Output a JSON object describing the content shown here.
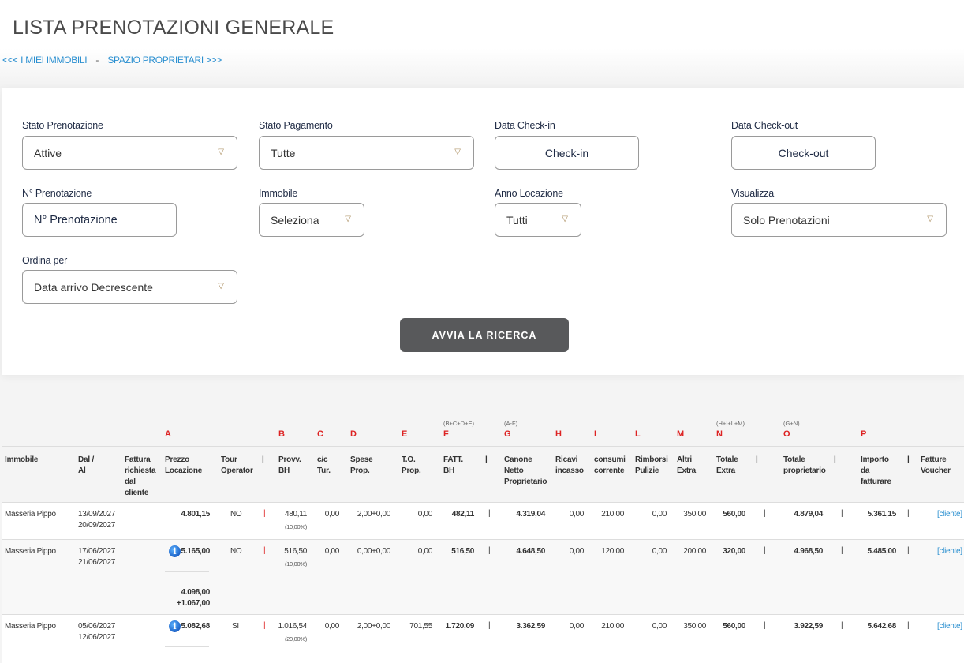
{
  "page": {
    "title": "LISTA PRENOTAZIONI GENERALE",
    "nav": {
      "back_link": "<<< I MIEI IMMOBILI",
      "separator": "-",
      "forward_link": "SPAZIO PROPRIETARI >>>"
    }
  },
  "filters": {
    "stato_prenotazione": {
      "label": "Stato Prenotazione",
      "value": "Attive"
    },
    "stato_pagamento": {
      "label": "Stato Pagamento",
      "value": "Tutte"
    },
    "data_checkin": {
      "label": "Data Check-in",
      "placeholder": "Check-in"
    },
    "data_checkout": {
      "label": "Data Check-out",
      "placeholder": "Check-out"
    },
    "numero_prenotazione": {
      "label": "N° Prenotazione",
      "placeholder": "N° Prenotazione"
    },
    "immobile": {
      "label": "Immobile",
      "value": "Seleziona"
    },
    "anno_locazione": {
      "label": "Anno Locazione",
      "value": "Tutti"
    },
    "visualizza": {
      "label": "Visualizza",
      "value": "Solo Prenotazioni"
    },
    "ordina_per": {
      "label": "Ordina per",
      "value": "Data arrivo Decrescente"
    },
    "caret_icon": "triangle-down-icon",
    "search_button": "AVVIA LA RICERCA"
  },
  "table": {
    "formulas": {
      "F": "(B+C+D+E)",
      "G": "(A-F)",
      "N": "(H+I+L+M)",
      "O": "(G+N)"
    },
    "letters": {
      "A": "A",
      "B": "B",
      "C": "C",
      "D": "D",
      "E": "E",
      "F": "F",
      "G": "G",
      "H": "H",
      "I": "I",
      "L": "L",
      "M": "M",
      "N": "N",
      "O": "O",
      "P": "P"
    },
    "headers": {
      "immobile": "Immobile",
      "dal_al": [
        "Dal /",
        "Al"
      ],
      "fattura": [
        "Fattura",
        "richiesta",
        "dal",
        "cliente"
      ],
      "prezzo": [
        "Prezzo",
        "Locazione"
      ],
      "tour": [
        "Tour",
        "Operator"
      ],
      "provv": [
        "Provv.",
        "BH"
      ],
      "cc": [
        "c/c",
        "Tur."
      ],
      "spese": [
        "Spese",
        "Prop."
      ],
      "to": [
        "T.O.",
        "Prop."
      ],
      "fatt": [
        "FATT.",
        "BH"
      ],
      "canone": [
        "Canone",
        "Netto",
        "Proprietario"
      ],
      "ricavi": [
        "Ricavi",
        "incasso"
      ],
      "consumi": [
        "consumi",
        "corrente"
      ],
      "rimborsi": [
        "Rimborsi",
        "Pulizie"
      ],
      "altri": [
        "Altri",
        "Extra"
      ],
      "totale_extra": [
        "Totale",
        "Extra"
      ],
      "totale_prop": [
        "Totale",
        "proprietario"
      ],
      "importo": [
        "Importo",
        "da",
        "fatturare"
      ],
      "fatture": [
        "Fatture",
        "Voucher"
      ],
      "pipe": "|"
    },
    "rows": [
      {
        "immobile": "Masseria Pippo",
        "dal": "13/09/2027",
        "al": "20/09/2027",
        "prezzo": "4.801,15",
        "tour": "NO",
        "provv": "480,11",
        "provv_pct": "(10,00%)",
        "cc": "0,00",
        "spese": "2,00+0,00",
        "to": "0,00",
        "fatt": "482,11",
        "canone": "4.319,04",
        "ricavi": "0,00",
        "consumi": "210,00",
        "rimborsi": "0,00",
        "altri": "350,00",
        "totale_extra": "560,00",
        "totale_prop": "4.879,04",
        "importo": "5.361,15",
        "voucher": "[cliente]"
      },
      {
        "immobile": "Masseria Pippo",
        "dal": "17/06/2027",
        "al": "21/06/2027",
        "prezzo": "5.165,00",
        "prezzo_detail": [
          "4.098,00",
          "+1.067,00"
        ],
        "info_icon": "info-icon",
        "tour": "NO",
        "provv": "516,50",
        "provv_pct": "(10,00%)",
        "cc": "0,00",
        "spese": "0,00+0,00",
        "to": "0,00",
        "fatt": "516,50",
        "canone": "4.648,50",
        "ricavi": "0,00",
        "consumi": "120,00",
        "rimborsi": "0,00",
        "altri": "200,00",
        "totale_extra": "320,00",
        "totale_prop": "4.968,50",
        "importo": "5.485,00",
        "voucher": "[cliente]"
      },
      {
        "immobile": "Masseria Pippo",
        "dal": "05/06/2027",
        "al": "12/06/2027",
        "prezzo": "5.082,68",
        "info_icon": "info-icon",
        "tour": "SI",
        "provv": "1.016,54",
        "provv_pct": "(20,00%)",
        "cc": "0,00",
        "spese": "2,00+0,00",
        "to": "701,55",
        "fatt": "1.720,09",
        "canone": "3.362,59",
        "ricavi": "0,00",
        "consumi": "210,00",
        "rimborsi": "0,00",
        "altri": "350,00",
        "totale_extra": "560,00",
        "totale_prop": "3.922,59",
        "importo": "5.642,68",
        "voucher": "[cliente]"
      }
    ]
  }
}
